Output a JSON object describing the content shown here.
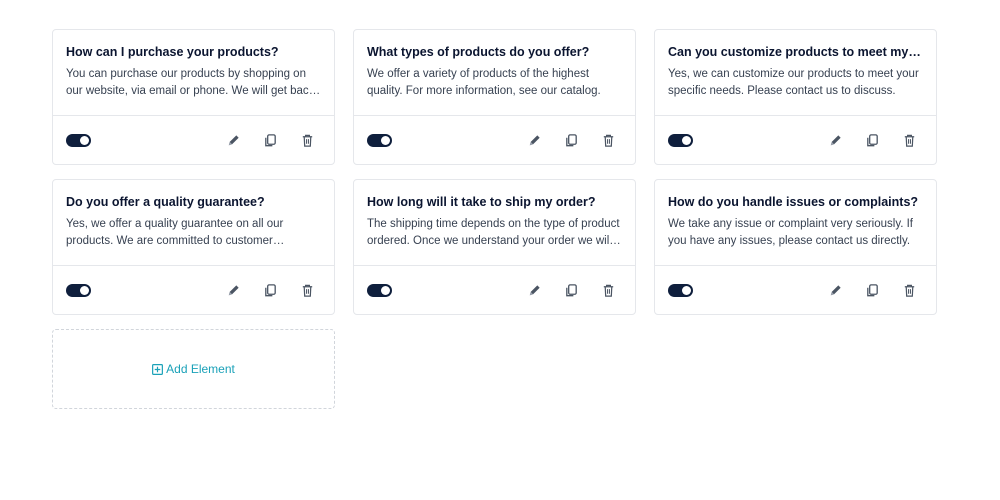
{
  "cards": [
    {
      "title": "How can I purchase your products?",
      "description": "You can purchase our products by shopping on our website, via email or phone. We will get back to you shortly.",
      "enabled": true
    },
    {
      "title": "What types of products do you offer?",
      "description": "We offer a variety of products of the highest quality. For more information, see our catalog.",
      "enabled": true
    },
    {
      "title": "Can you customize products to meet my needs?",
      "description": "Yes, we can customize our products to meet your specific needs. Please contact us to discuss.",
      "enabled": true
    },
    {
      "title": "Do you offer a quality guarantee?",
      "description": "Yes, we offer a quality guarantee on all our products. We are committed to customer satisfaction.",
      "enabled": true
    },
    {
      "title": "How long will it take to ship my order?",
      "description": "The shipping time depends on the type of product ordered. Once we understand your order we will let you know.",
      "enabled": true
    },
    {
      "title": "How do you handle issues or complaints?",
      "description": "We take any issue or complaint very seriously. If you have any issues, please contact us directly.",
      "enabled": true
    }
  ],
  "add_element_label": "Add Element",
  "colors": {
    "toggle": "#0f1f3d",
    "accent": "#1aa1b8",
    "icon": "#4b5563"
  }
}
